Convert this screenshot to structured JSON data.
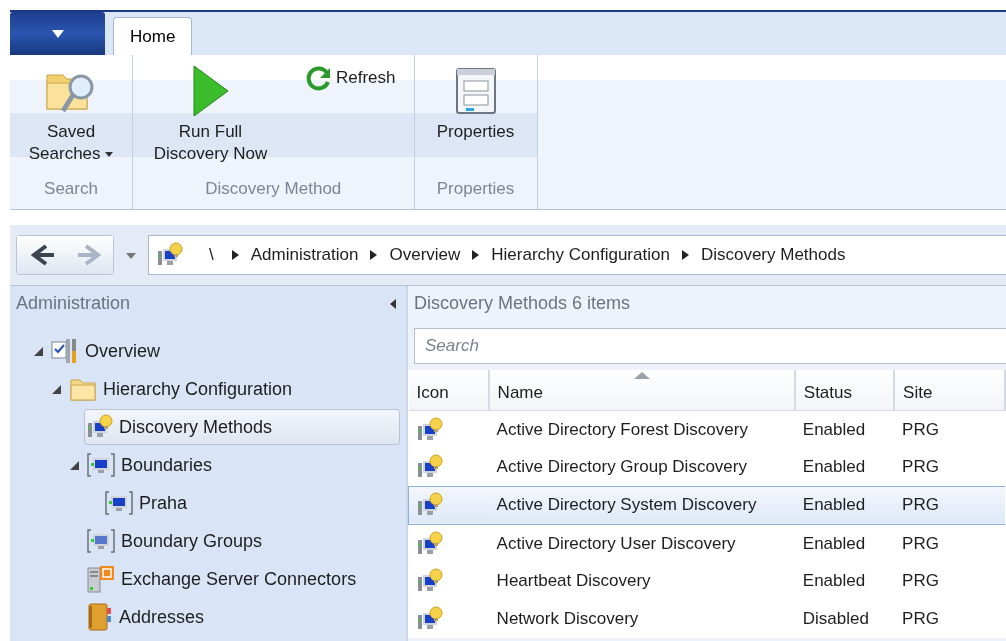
{
  "ribbon": {
    "tabs": [
      {
        "label": "Home",
        "selected": true
      }
    ],
    "groups": [
      {
        "caption": "Search",
        "buttons": [
          {
            "kind": "saved-searches",
            "label": "Saved Searches",
            "dropdown": true
          }
        ]
      },
      {
        "caption": "Discovery Method",
        "buttons": [
          {
            "kind": "run",
            "label": "Run Full Discovery Now"
          },
          {
            "kind": "refresh",
            "label": "Refresh"
          }
        ]
      },
      {
        "caption": "Properties",
        "buttons": [
          {
            "kind": "properties",
            "label": "Properties"
          }
        ]
      }
    ]
  },
  "navigation": {
    "back_enabled": true,
    "forward_enabled": false,
    "breadcrumb": [
      "\\",
      "Administration",
      "Overview",
      "Hierarchy Configuration",
      "Discovery Methods"
    ]
  },
  "sidebar": {
    "title": "Administration",
    "items": [
      {
        "label": "Overview",
        "kind": "overview",
        "expanded": true,
        "selected": false,
        "children": [
          {
            "label": "Hierarchy Configuration",
            "kind": "folder",
            "expanded": true,
            "selected": false,
            "children": [
              {
                "label": "Discovery Methods",
                "kind": "discovery",
                "selected": true
              },
              {
                "label": "Boundaries",
                "kind": "boundary",
                "expanded": true,
                "selected": false,
                "children": [
                  {
                    "label": "Praha",
                    "kind": "boundary",
                    "selected": false
                  }
                ]
              },
              {
                "label": "Boundary Groups",
                "kind": "boundary-group",
                "selected": false
              },
              {
                "label": "Exchange Server Connectors",
                "kind": "exchange",
                "selected": false
              },
              {
                "label": "Addresses",
                "kind": "addresses",
                "selected": false
              }
            ]
          }
        ]
      }
    ]
  },
  "content": {
    "title": "Discovery Methods 6 items",
    "search": {
      "placeholder": "Search"
    },
    "table": {
      "columns": [
        {
          "label": "Icon",
          "sorted": false
        },
        {
          "label": "Name",
          "sorted": true
        },
        {
          "label": "Status",
          "sorted": false
        },
        {
          "label": "Site",
          "sorted": false
        }
      ],
      "rows": [
        {
          "name": "Active Directory Forest Discovery",
          "status": "Enabled",
          "site": "PRG",
          "selected": false
        },
        {
          "name": "Active Directory Group Discovery",
          "status": "Enabled",
          "site": "PRG",
          "selected": false
        },
        {
          "name": "Active Directory System Discovery",
          "status": "Enabled",
          "site": "PRG",
          "selected": true
        },
        {
          "name": "Active Directory User Discovery",
          "status": "Enabled",
          "site": "PRG",
          "selected": false
        },
        {
          "name": "Heartbeat Discovery",
          "status": "Enabled",
          "site": "PRG",
          "selected": false
        },
        {
          "name": "Network Discovery",
          "status": "Disabled",
          "site": "PRG",
          "selected": false
        }
      ]
    }
  }
}
